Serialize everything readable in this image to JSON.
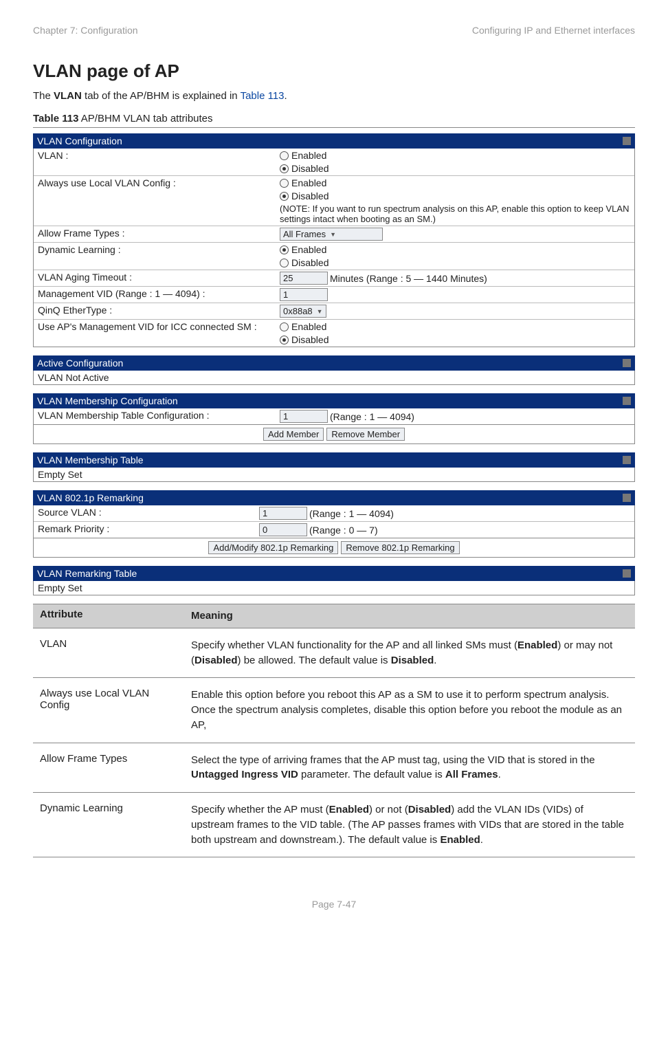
{
  "header": {
    "left": "Chapter 7:  Configuration",
    "right": "Configuring IP and Ethernet interfaces"
  },
  "title": "VLAN page of AP",
  "intro_pre": "The ",
  "intro_bold": "VLAN",
  "intro_mid": " tab of the AP/BHM is explained in ",
  "intro_link": "Table 113",
  "intro_post": ".",
  "table_caption_bold": "Table 113",
  "table_caption_rest": " AP/BHM VLAN tab attributes",
  "panel1": {
    "title": "VLAN Configuration",
    "rows": {
      "vlan_label": "VLAN :",
      "enabled": "Enabled",
      "disabled": "Disabled",
      "local_label": "Always use Local VLAN Config :",
      "local_note": "(NOTE: If you want to run spectrum analysis on this AP, enable this option to keep VLAN settings intact when booting as an SM.)",
      "allow_frame_label": "Allow Frame Types :",
      "allow_frame_value": "All Frames",
      "dyn_label": "Dynamic Learning :",
      "aging_label": "VLAN Aging Timeout :",
      "aging_value": "25",
      "aging_suffix": "Minutes (Range : 5 — 1440 Minutes)",
      "mgmt_label": "Management VID (Range : 1 — 4094) :",
      "mgmt_value": "1",
      "qinq_label": "QinQ EtherType :",
      "qinq_value": "0x88a8",
      "icc_label": "Use AP's Management VID for ICC connected SM :"
    }
  },
  "panel2": {
    "title": "Active Configuration",
    "body": "VLAN Not Active"
  },
  "panel3": {
    "title": "VLAN Membership Configuration",
    "label": "VLAN Membership Table Configuration :",
    "value": "1",
    "range": "(Range : 1 — 4094)",
    "btn_add": "Add Member",
    "btn_remove": "Remove Member"
  },
  "panel4": {
    "title": "VLAN Membership Table",
    "body": "Empty Set"
  },
  "panel5": {
    "title": "VLAN 802.1p Remarking",
    "src_label": "Source VLAN :",
    "src_value": "1",
    "src_range": "(Range : 1 — 4094)",
    "pri_label": "Remark Priority :",
    "pri_value": "0",
    "pri_range": "(Range : 0 — 7)",
    "btn_add": "Add/Modify 802.1p Remarking",
    "btn_remove": "Remove 802.1p Remarking"
  },
  "panel6": {
    "title": "VLAN Remarking Table",
    "body": "Empty Set"
  },
  "attr_table": {
    "head_attr": "Attribute",
    "head_mean": "Meaning",
    "rows": [
      {
        "attr": "VLAN",
        "segments": [
          {
            "t": "Specify whether VLAN functionality for the AP and all linked SMs must ("
          },
          {
            "t": "Enabled",
            "b": true
          },
          {
            "t": ") or may not ("
          },
          {
            "t": "Disabled",
            "b": true
          },
          {
            "t": ") be allowed. The default value is "
          },
          {
            "t": "Disabled",
            "b": true
          },
          {
            "t": "."
          }
        ]
      },
      {
        "attr": "Always use Local VLAN Config",
        "segments": [
          {
            "t": "Enable this option before you reboot this AP as a SM to use it to perform spectrum analysis. Once the spectrum analysis completes, disable this option before you reboot the module as an AP,"
          }
        ]
      },
      {
        "attr": "Allow Frame Types",
        "segments": [
          {
            "t": "Select the type of arriving frames that the AP must tag, using the VID that is stored in the "
          },
          {
            "t": "Untagged Ingress VID",
            "b": true
          },
          {
            "t": " parameter. The default value is "
          },
          {
            "t": "All Frames",
            "b": true
          },
          {
            "t": "."
          }
        ]
      },
      {
        "attr": "Dynamic Learning",
        "segments": [
          {
            "t": "Specify whether the AP must ("
          },
          {
            "t": "Enabled",
            "b": true
          },
          {
            "t": ") or not ("
          },
          {
            "t": "Disabled",
            "b": true
          },
          {
            "t": ") add the VLAN IDs (VIDs) of upstream frames to the VID table. (The AP passes frames with VIDs that are stored in the table both upstream and downstream.). The default value is "
          },
          {
            "t": "Enabled",
            "b": true
          },
          {
            "t": "."
          }
        ]
      }
    ]
  },
  "footer": "Page 7-47"
}
